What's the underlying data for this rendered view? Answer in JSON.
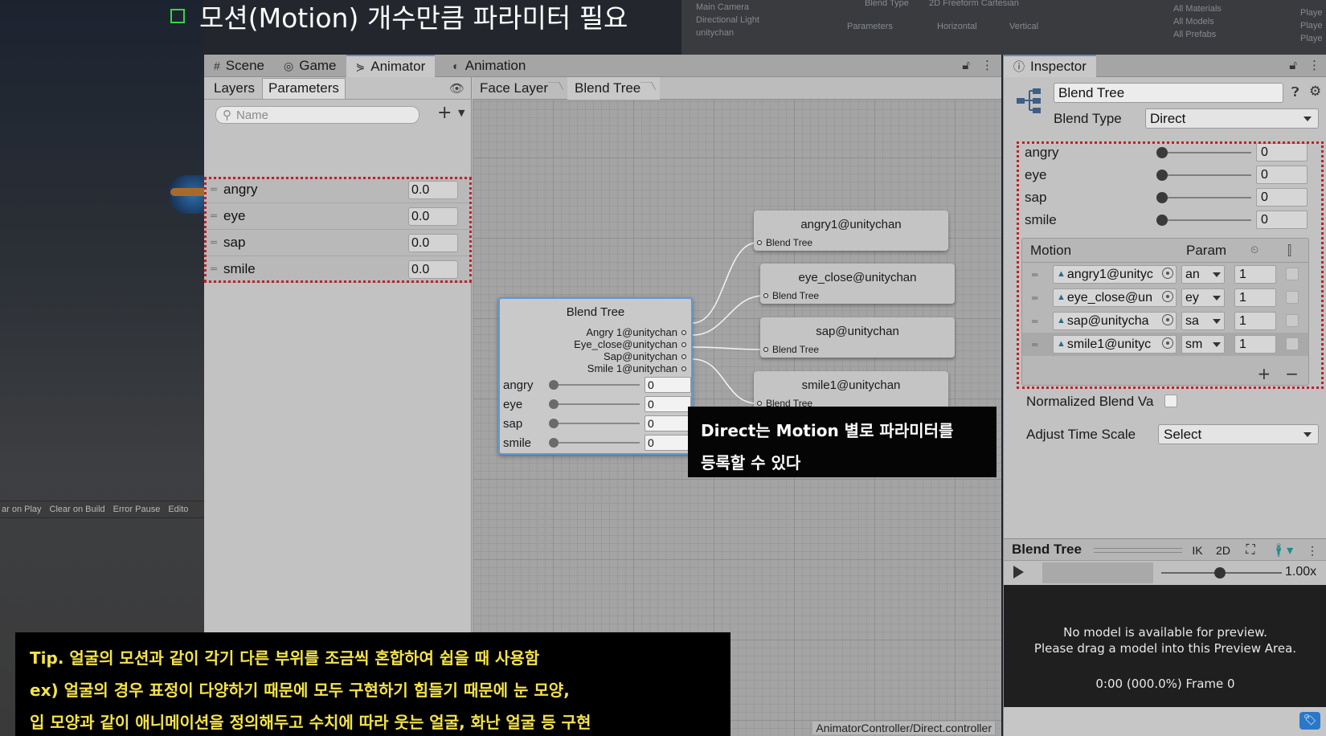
{
  "slide": {
    "title": "모션(Motion) 개수만큼 파라미터 필요",
    "callout": [
      "Direct는 Motion 별로 파라미터를",
      "등록할 수 있다"
    ],
    "tip": [
      "Tip. 얼굴의 모션과 같이 각기 다른 부위를 조금씩 혼합하여 쉽을 때 사용함",
      "ex) 얼굴의 경우 표정이 다양하기 때문에 모두 구현하기 힘들기 때문에 눈 모양,",
      "입 모양과 같이 애니메이션을 정의해두고 수치에 따라 웃는 얼굴, 화난 얼굴 등 구현"
    ]
  },
  "background_ui": {
    "hierarchy": [
      "Main Camera",
      "Directional Light",
      "unitychan"
    ],
    "blend_type_label": "Blend Type",
    "blend_type_value": "2D Freeform Cartesian",
    "parameters_label": "Parameters",
    "horizontal": "Horizontal",
    "vertical": "Vertical",
    "project_items": [
      "All Materials",
      "All Models",
      "All Prefabs"
    ],
    "console_buttons": [
      "ar on Play",
      "Clear on Build",
      "Error Pause",
      "Edito"
    ],
    "right_edge": [
      "Playe",
      "Playe",
      "Playe"
    ]
  },
  "animator": {
    "tabs": [
      {
        "label": "Scene",
        "icon": "#"
      },
      {
        "label": "Game",
        "icon": "◎"
      },
      {
        "label": "Animator",
        "icon": "⋟"
      },
      {
        "label": "Animation",
        "icon": "◐"
      }
    ],
    "subtabs": [
      "Layers",
      "Parameters"
    ],
    "search_placeholder": "Name",
    "parameters": [
      {
        "name": "angry",
        "value": "0.0"
      },
      {
        "name": "eye",
        "value": "0.0"
      },
      {
        "name": "sap",
        "value": "0.0"
      },
      {
        "name": "smile",
        "value": "0.0"
      }
    ],
    "breadcrumb": [
      "Face Layer",
      "Blend Tree"
    ],
    "path": "AnimatorController/Direct.controller",
    "blend_tree_node": {
      "title": "Blend Tree",
      "outputs": [
        "Angry 1@unitychan",
        "Eye_close@unitychan",
        "Sap@unitychan",
        "Smile 1@unitychan"
      ],
      "params": [
        {
          "name": "angry",
          "value": "0"
        },
        {
          "name": "eye",
          "value": "0"
        },
        {
          "name": "sap",
          "value": "0"
        },
        {
          "name": "smile",
          "value": "0"
        }
      ]
    },
    "motion_nodes": [
      {
        "title": "angry1@unitychan",
        "sub": "Blend Tree"
      },
      {
        "title": "eye_close@unitychan",
        "sub": "Blend Tree"
      },
      {
        "title": "sap@unitychan",
        "sub": "Blend Tree"
      },
      {
        "title": "smile1@unitychan",
        "sub": "Blend Tree"
      }
    ]
  },
  "inspector": {
    "tab": "Inspector",
    "name": "Blend Tree",
    "blend_type_label": "Blend Type",
    "blend_type": "Direct",
    "params": [
      {
        "name": "angry",
        "value": "0"
      },
      {
        "name": "eye",
        "value": "0"
      },
      {
        "name": "sap",
        "value": "0"
      },
      {
        "name": "smile",
        "value": "0"
      }
    ],
    "motion_header": "Motion",
    "param_header": "Param",
    "motions": [
      {
        "clip": "angry1@unityc",
        "param": "an",
        "threshold": "1"
      },
      {
        "clip": "eye_close@un",
        "param": "ey",
        "threshold": "1"
      },
      {
        "clip": "sap@unitycha",
        "param": "sa",
        "threshold": "1"
      },
      {
        "clip": "smile1@unityc",
        "param": "sm",
        "threshold": "1"
      }
    ],
    "normalized_label": "Normalized Blend Va",
    "adjust_time_scale_label": "Adjust Time Scale",
    "adjust_time_scale": "Select",
    "preview": {
      "title": "Blend Tree",
      "ik": "IK",
      "mode_2d": "2D",
      "speed": "1.00x",
      "msg1": "No model is available for preview.",
      "msg2": "Please drag a model into this Preview Area.",
      "frame": "0:00 (000.0%) Frame 0"
    }
  }
}
